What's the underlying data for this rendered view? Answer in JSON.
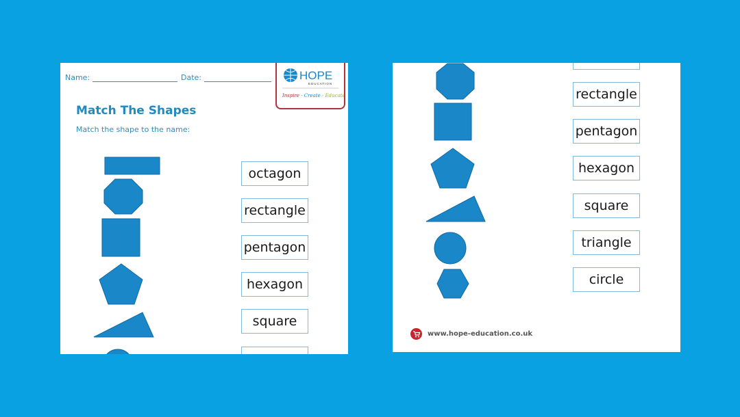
{
  "worksheet": {
    "name_label": "Name:",
    "date_label": "Date:",
    "title": "Match The Shapes",
    "instruction": "Match the shape to the name:",
    "logo": {
      "brand": "HOPE",
      "sub": "EDUCATION",
      "tagline": [
        "Inspire",
        "Create",
        "Educate"
      ]
    },
    "page1_labels": [
      "octagon",
      "rectangle",
      "pentagon",
      "hexagon",
      "square"
    ],
    "page2_labels": [
      "rectangle",
      "pentagon",
      "hexagon",
      "square",
      "triangle",
      "circle"
    ],
    "footer_url": "www.hope-education.co.uk",
    "colors": {
      "background": "#0aa1e2",
      "shape": "#1a87c9",
      "label_border": "#7fb9dc",
      "logo_border": "#b0303b"
    }
  }
}
